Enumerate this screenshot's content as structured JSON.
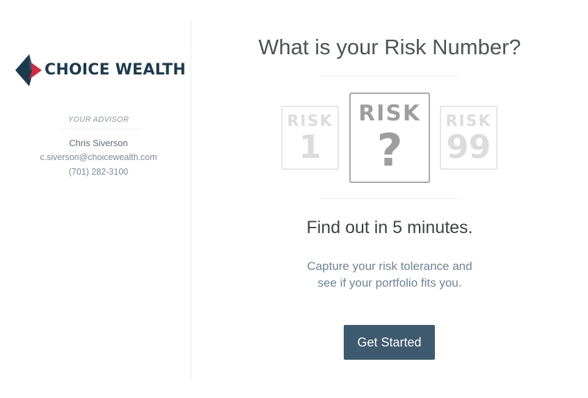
{
  "brand": {
    "name": "CHOICE WEALTH",
    "logo_icon": "diamond-star-icon",
    "colors": {
      "navy": "#1c3b4e",
      "red": "#d7263d"
    }
  },
  "advisor": {
    "label": "YOUR ADVISOR",
    "name": "Chris Siverson",
    "email": "c.siverson@choicewealth.com",
    "phone": "(701) 282-3100"
  },
  "main": {
    "headline": "What is your Risk Number?",
    "signs": [
      {
        "word": "RISK",
        "value": "1"
      },
      {
        "word": "RISK",
        "value": "?"
      },
      {
        "word": "RISK",
        "value": "99"
      }
    ],
    "subhead": "Find out in 5 minutes.",
    "description_line1": "Capture your risk tolerance and",
    "description_line2": "see if your portfolio fits you.",
    "cta_label": "Get Started",
    "cta_color": "#3e5a6e"
  }
}
